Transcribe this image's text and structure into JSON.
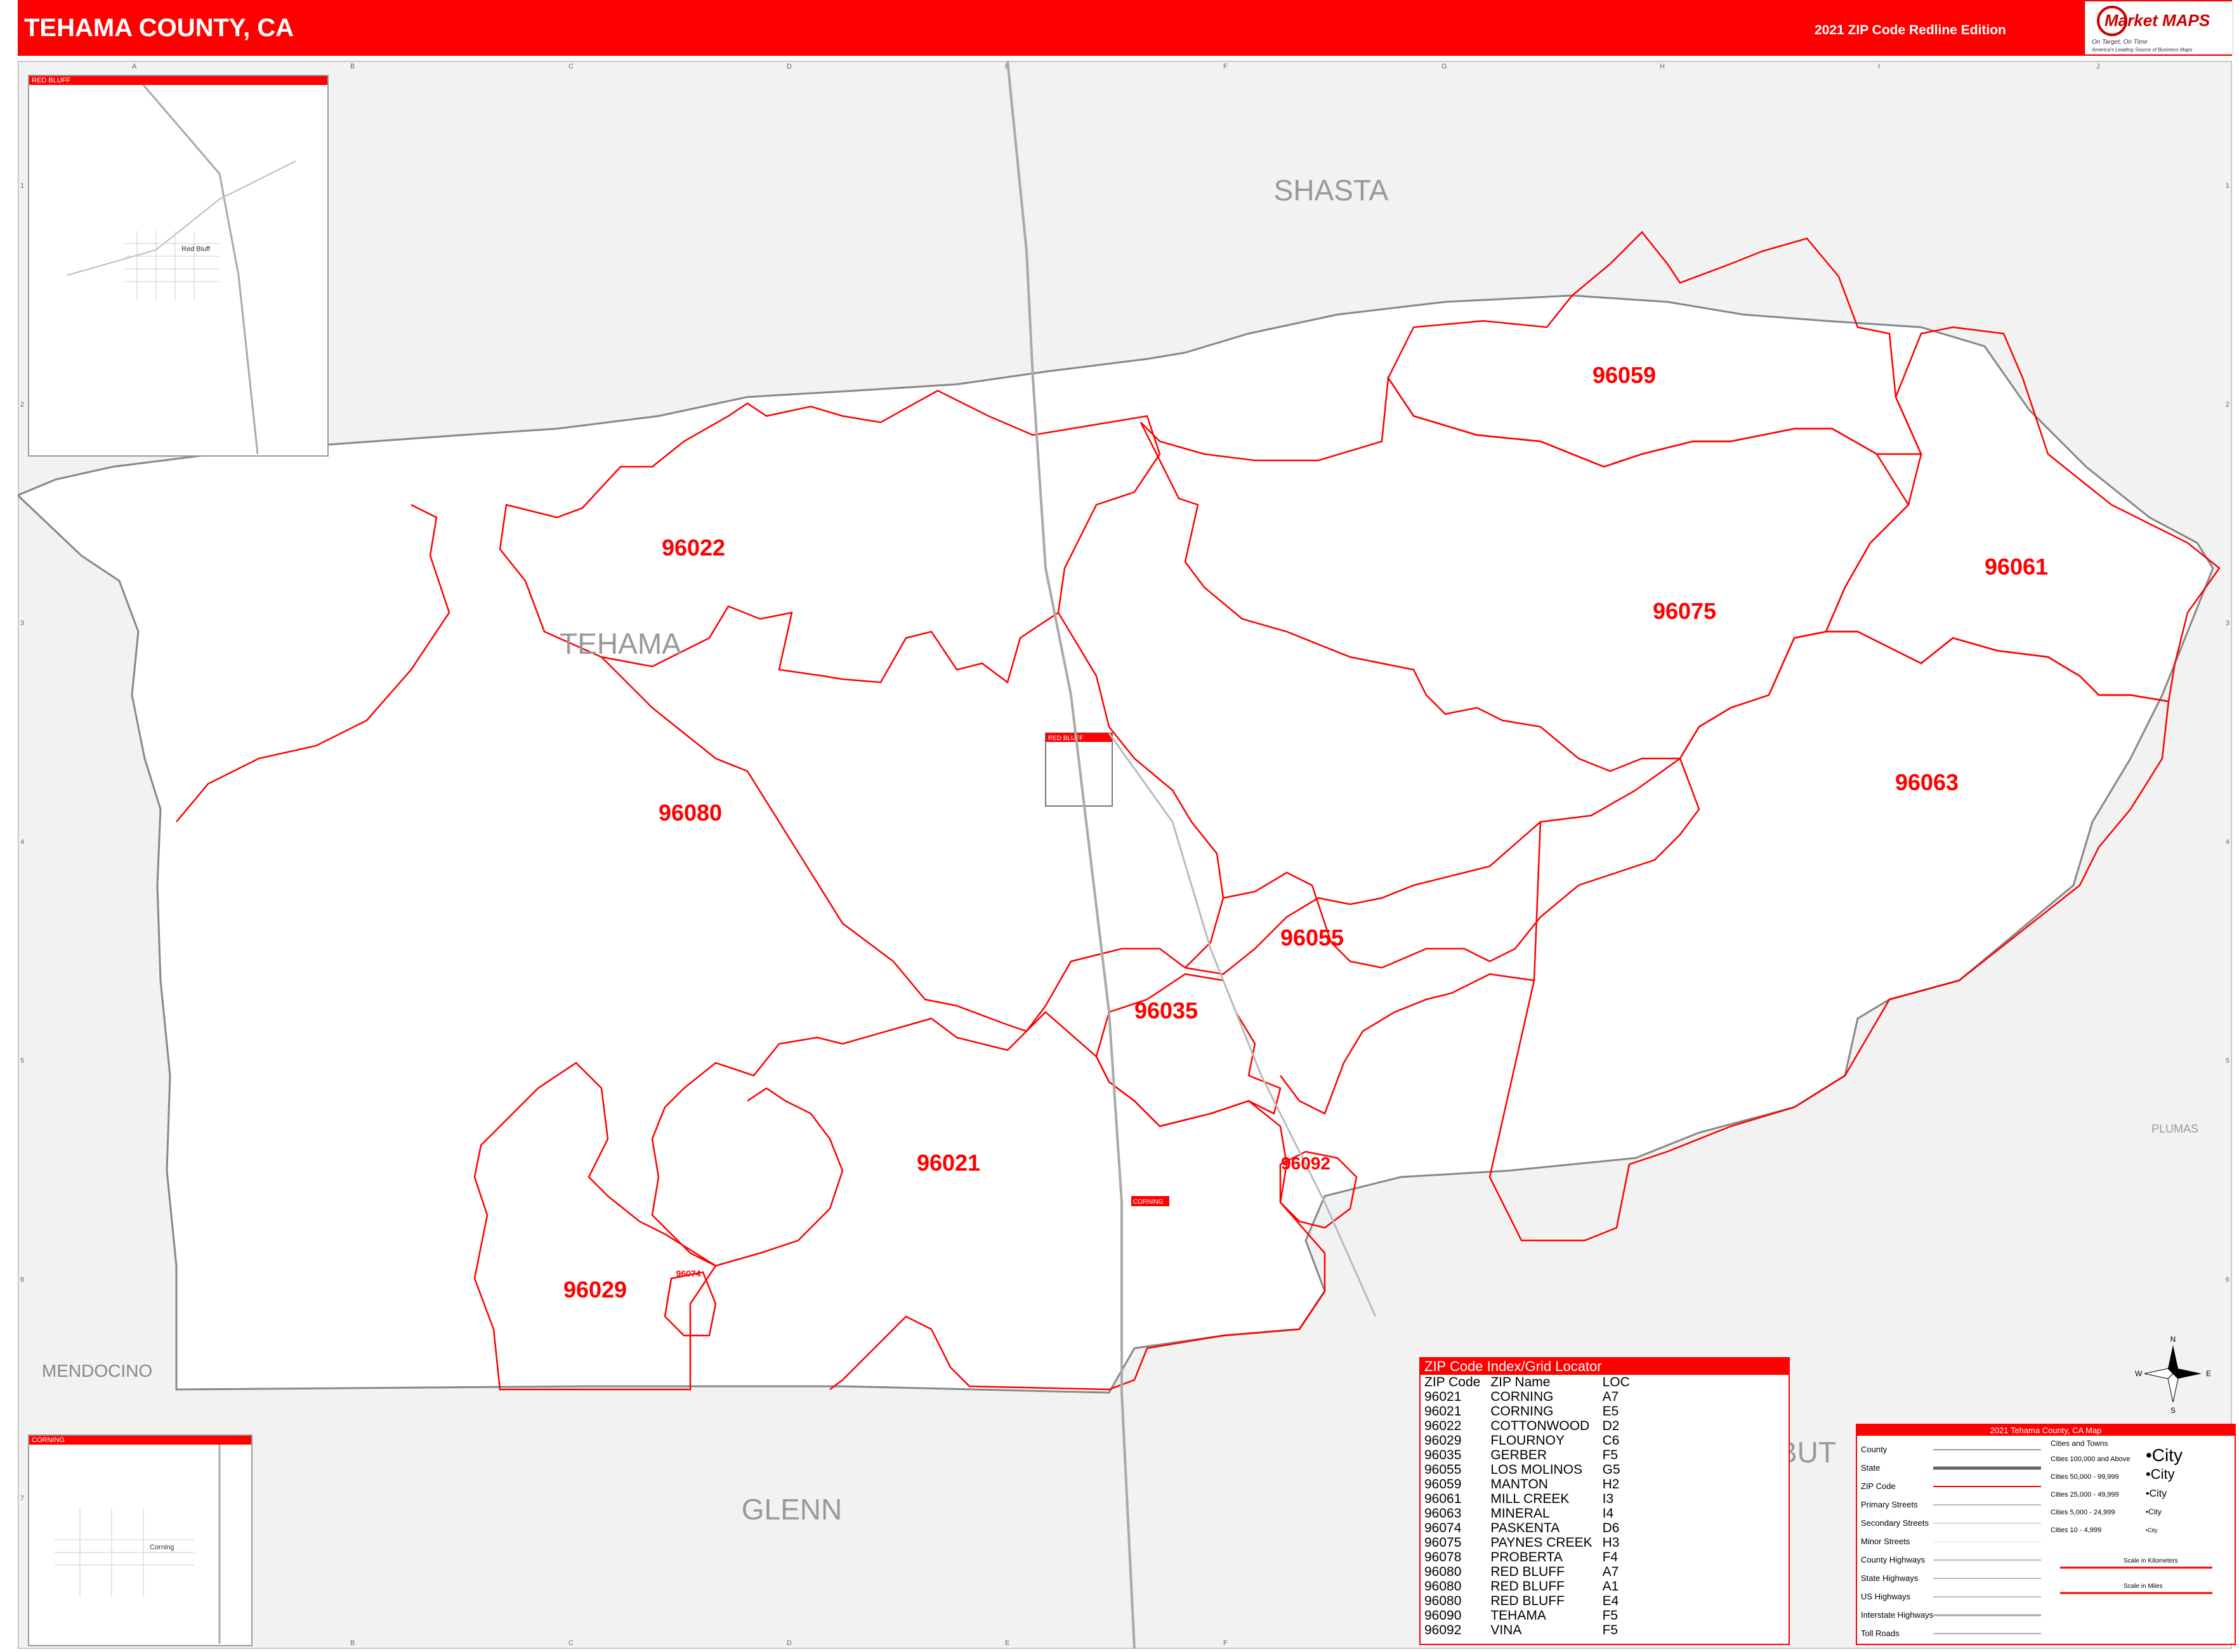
{
  "header": {
    "title": "TEHAMA COUNTY, CA",
    "edition": "2021 ZIP Code Redline Edition",
    "logo_text": "Market MAPS",
    "logo_tagline": "On Target, On Time",
    "logo_subtagline": "America's Leading Source of Business Maps"
  },
  "grid": {
    "columns": [
      "A",
      "B",
      "C",
      "D",
      "E",
      "F",
      "G",
      "H",
      "I",
      "J"
    ],
    "rows": [
      "1",
      "2",
      "3",
      "4",
      "5",
      "6",
      "7"
    ]
  },
  "counties": {
    "shasta": "SHASTA",
    "tehama": "TEHAMA",
    "mendocino": "MENDOCINO",
    "glenn": "GLENN",
    "butte": "BUT",
    "plumas": "PLUMAS"
  },
  "zips": {
    "z96059": "96059",
    "z96022": "96022",
    "z96075": "96075",
    "z96061": "96061",
    "z96080": "96080",
    "z96063": "96063",
    "z96055": "96055",
    "z96035": "96035",
    "z96021": "96021",
    "z96092": "96092",
    "z96029": "96029",
    "z96074": "96074"
  },
  "places": {
    "red_bluff_box": "RED BLUFF",
    "corning_box": "CORNING"
  },
  "insets": {
    "red_bluff_title": "RED BLUFF",
    "red_bluff_city": "Red Bluff",
    "corning_title": "CORNING",
    "corning_city": "Corning"
  },
  "zip_index": {
    "title": "ZIP Code Index/Grid Locator",
    "headers": [
      "ZIP Code",
      "ZIP Name",
      "LOC"
    ],
    "rows": [
      [
        "96021",
        "CORNING",
        "A7"
      ],
      [
        "96021",
        "CORNING",
        "E5"
      ],
      [
        "96022",
        "COTTONWOOD",
        "D2"
      ],
      [
        "96029",
        "FLOURNOY",
        "C6"
      ],
      [
        "96035",
        "GERBER",
        "F5"
      ],
      [
        "96055",
        "LOS MOLINOS",
        "G5"
      ],
      [
        "96059",
        "MANTON",
        "H2"
      ],
      [
        "96061",
        "MILL CREEK",
        "I3"
      ],
      [
        "96063",
        "MINERAL",
        "I4"
      ],
      [
        "96074",
        "PASKENTA",
        "D6"
      ],
      [
        "96075",
        "PAYNES CREEK",
        "H3"
      ],
      [
        "96078",
        "PROBERTA",
        "F4"
      ],
      [
        "96080",
        "RED BLUFF",
        "A7"
      ],
      [
        "96080",
        "RED BLUFF",
        "A1"
      ],
      [
        "96080",
        "RED BLUFF",
        "E4"
      ],
      [
        "96090",
        "TEHAMA",
        "F5"
      ],
      [
        "96092",
        "VINA",
        "F5"
      ]
    ]
  },
  "legend": {
    "title": "2021 Tehama County, CA Map",
    "items": [
      "County",
      "State",
      "ZIP Code",
      "Primary Streets",
      "Secondary Streets",
      "Minor Streets",
      "County Highways",
      "State Highways",
      "US Highways",
      "Interstate Highways",
      "Toll Roads"
    ],
    "cities_title": "Cities and Towns",
    "cities": [
      {
        "range": "Cities 100,000 and Above",
        "sample": "City"
      },
      {
        "range": "Cities 50,000 - 99,999",
        "sample": "City"
      },
      {
        "range": "Cities 25,000 - 49,999",
        "sample": "City"
      },
      {
        "range": "Cities 5,000 - 24,999",
        "sample": "City"
      },
      {
        "range": "Cities 10 - 4,999",
        "sample": "City"
      }
    ],
    "scale_km": "Scale in Kilometers",
    "scale_mi": "Scale in Miles"
  },
  "compass": {
    "n": "N",
    "s": "S",
    "e": "E",
    "w": "W"
  },
  "colors": {
    "accent": "#ff0000",
    "background": "#f2f2f2",
    "county_fill": "#ffffff",
    "roads": "#999999",
    "county_label": "#999999"
  }
}
